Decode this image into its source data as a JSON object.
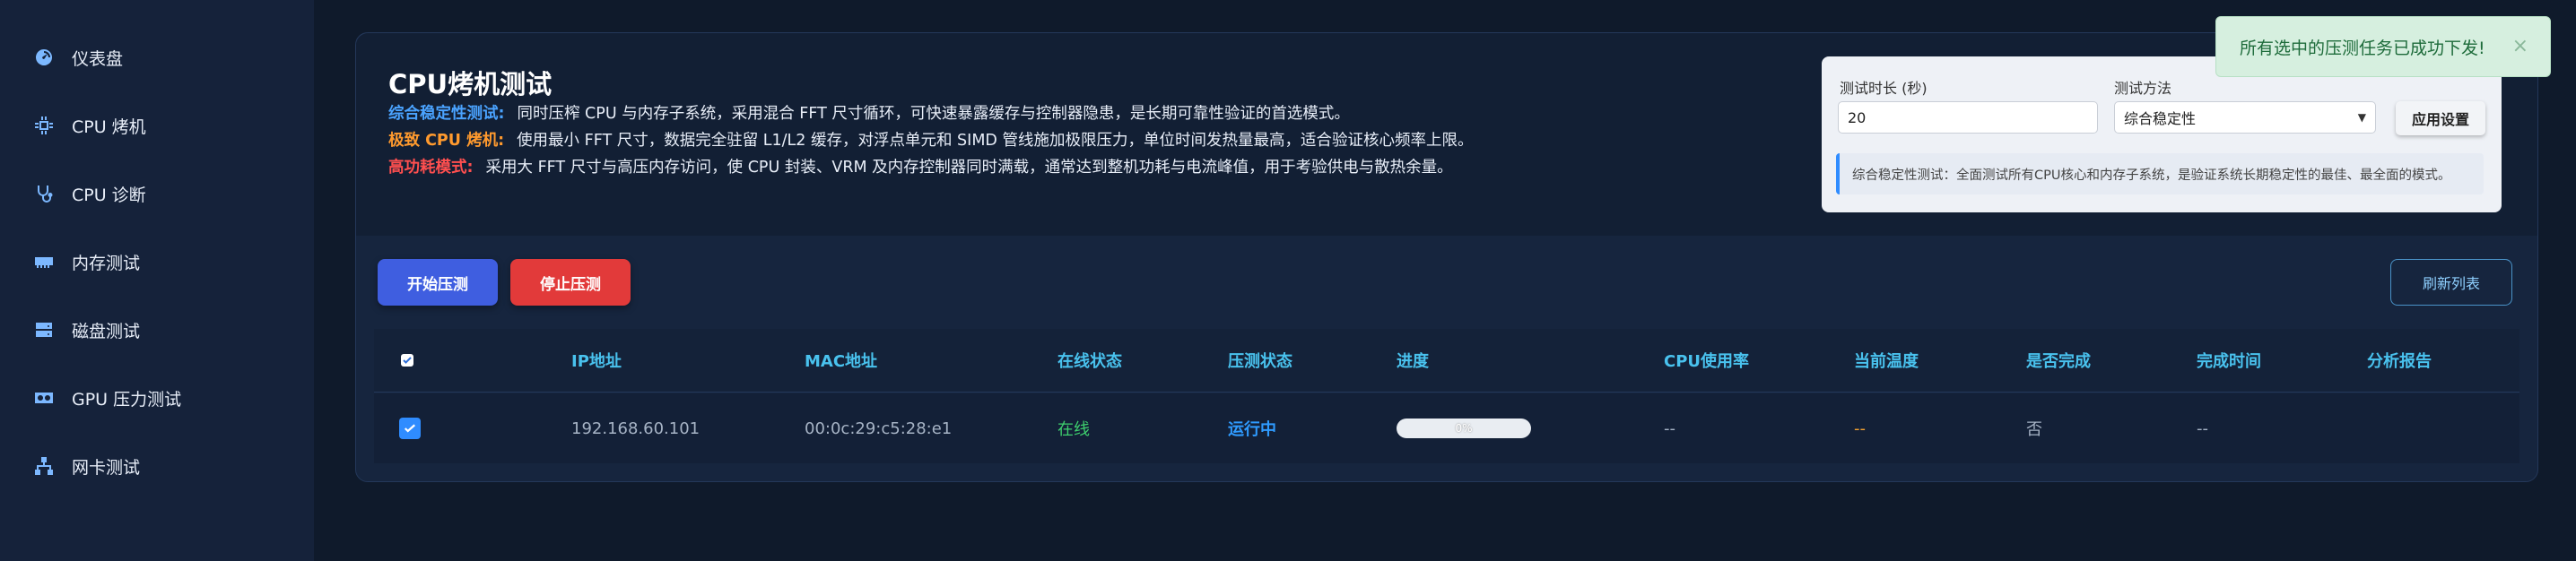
{
  "sidebar": {
    "items": [
      {
        "label": "仪表盘",
        "icon": "dashboard-icon"
      },
      {
        "label": "CPU 烤机",
        "icon": "cpu-icon"
      },
      {
        "label": "CPU 诊断",
        "icon": "stethoscope-icon"
      },
      {
        "label": "内存测试",
        "icon": "memory-icon"
      },
      {
        "label": "磁盘测试",
        "icon": "disk-icon"
      },
      {
        "label": "GPU 压力测试",
        "icon": "gpu-icon"
      },
      {
        "label": "网卡测试",
        "icon": "network-icon"
      }
    ]
  },
  "header": {
    "title": "CPU烤机测试",
    "modes": [
      {
        "key": "综合稳定性测试:",
        "text": "同时压榨 CPU 与内存子系统，采用混合 FFT 尺寸循环，可快速暴露缓存与控制器隐患，是长期可靠性验证的首选模式。"
      },
      {
        "key": "极致 CPU 烤机:",
        "text": "使用最小 FFT 尺寸，数据完全驻留 L1/L2 缓存，对浮点单元和 SIMD 管线施加极限压力，单位时间发热量最高，适合验证核心频率上限。"
      },
      {
        "key": "高功耗模式:",
        "text": "采用大 FFT 尺寸与高压内存访问，使 CPU 封装、VRM 及内存控制器同时满载，通常达到整机功耗与电流峰值，用于考验供电与散热余量。"
      }
    ]
  },
  "settings": {
    "duration_label": "测试时长 (秒)",
    "duration_value": "20",
    "method_label": "测试方法",
    "method_value": "综合稳定性",
    "apply_label": "应用设置",
    "info_text": "综合稳定性测试：全面测试所有CPU核心和内存子系统，是验证系统长期稳定性的最佳、最全面的模式。"
  },
  "actions": {
    "start_label": "开始压测",
    "stop_label": "停止压测",
    "refresh_label": "刷新列表"
  },
  "table": {
    "headers": [
      "IP地址",
      "MAC地址",
      "在线状态",
      "压测状态",
      "进度",
      "CPU使用率",
      "当前温度",
      "是否完成",
      "完成时间",
      "分析报告"
    ],
    "rows": [
      {
        "checked": true,
        "ip": "192.168.60.101",
        "mac": "00:0c:29:c5:28:e1",
        "online": "在线",
        "status": "运行中",
        "progress_pct": 0,
        "progress_text": "0%",
        "cpu": "--",
        "temp": "--",
        "done": "否",
        "done_time": "--",
        "report": ""
      }
    ]
  },
  "toast": {
    "message": "所有选中的压测任务已成功下发!",
    "close": "×"
  },
  "colors": {
    "online": "#3ecf6e",
    "running": "#2f9bff",
    "temp": "#f0a030",
    "header_text": "#49c2ee"
  }
}
